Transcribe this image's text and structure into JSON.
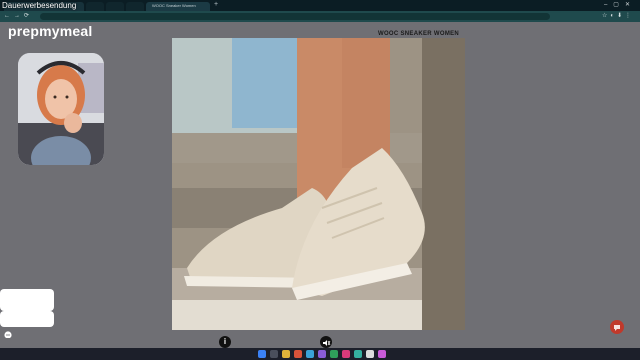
{
  "overlay": {
    "ad_label": "Dauerwerbesendung"
  },
  "browser": {
    "tabs": [
      "",
      "",
      "",
      "",
      ""
    ],
    "active_tab_title": "WOOC Sneaker Women",
    "new_tab_icon": "+",
    "window_controls": "–▢✕",
    "nav_icons": "←→⟳",
    "toolbar_icons": "☆◐⬇⋮"
  },
  "brand": {
    "logo_text": "prepmymeal"
  },
  "product": {
    "caption": "WOOC SNEAKER WOMEN",
    "image_icon": "sneaker-photo"
  },
  "chat": {
    "messages": [
      {
        "text": ""
      },
      {
        "text": ""
      }
    ],
    "icon": "chat-bubble-icon"
  },
  "controls": {
    "info_icon": "i",
    "mute_icon": "speaker-mute-icon",
    "help_icon": "help-bubble-icon"
  },
  "taskbar": {
    "time": "",
    "date": ""
  },
  "colors": {
    "page_bg": "#6f6f74",
    "browser_bar": "#1f4a4d",
    "help_fab": "#c0392b",
    "taskbar": "#1c1f2a"
  }
}
